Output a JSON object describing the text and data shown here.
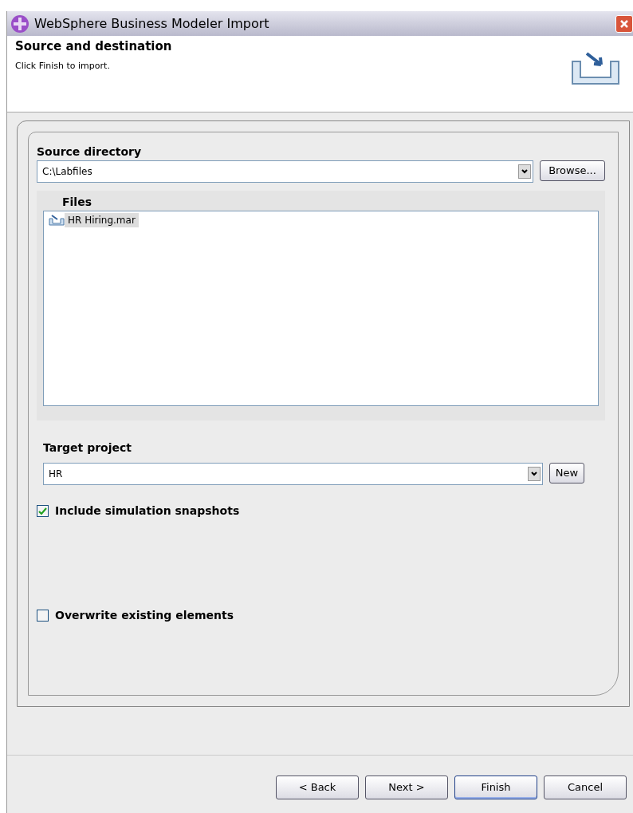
{
  "window": {
    "title": "WebSphere Business Modeler Import"
  },
  "header": {
    "title": "Source and destination",
    "description": "Click Finish to import."
  },
  "source": {
    "label": "Source directory",
    "value": "C:\\Labfiles",
    "browse_button": "Browse..."
  },
  "files": {
    "label": "Files",
    "items": [
      {
        "name": "HR Hiring.mar",
        "selected": true
      }
    ]
  },
  "target": {
    "label": "Target project",
    "value": "HR",
    "new_button": "New"
  },
  "options": [
    {
      "label": "Include simulation snapshots",
      "checked": true
    },
    {
      "label": "Overwrite existing elements",
      "checked": false
    }
  ],
  "buttons": [
    {
      "label": "< Back",
      "default": false
    },
    {
      "label": "Next >",
      "default": false
    },
    {
      "label": "Finish",
      "default": true
    },
    {
      "label": "Cancel",
      "default": false
    }
  ]
}
